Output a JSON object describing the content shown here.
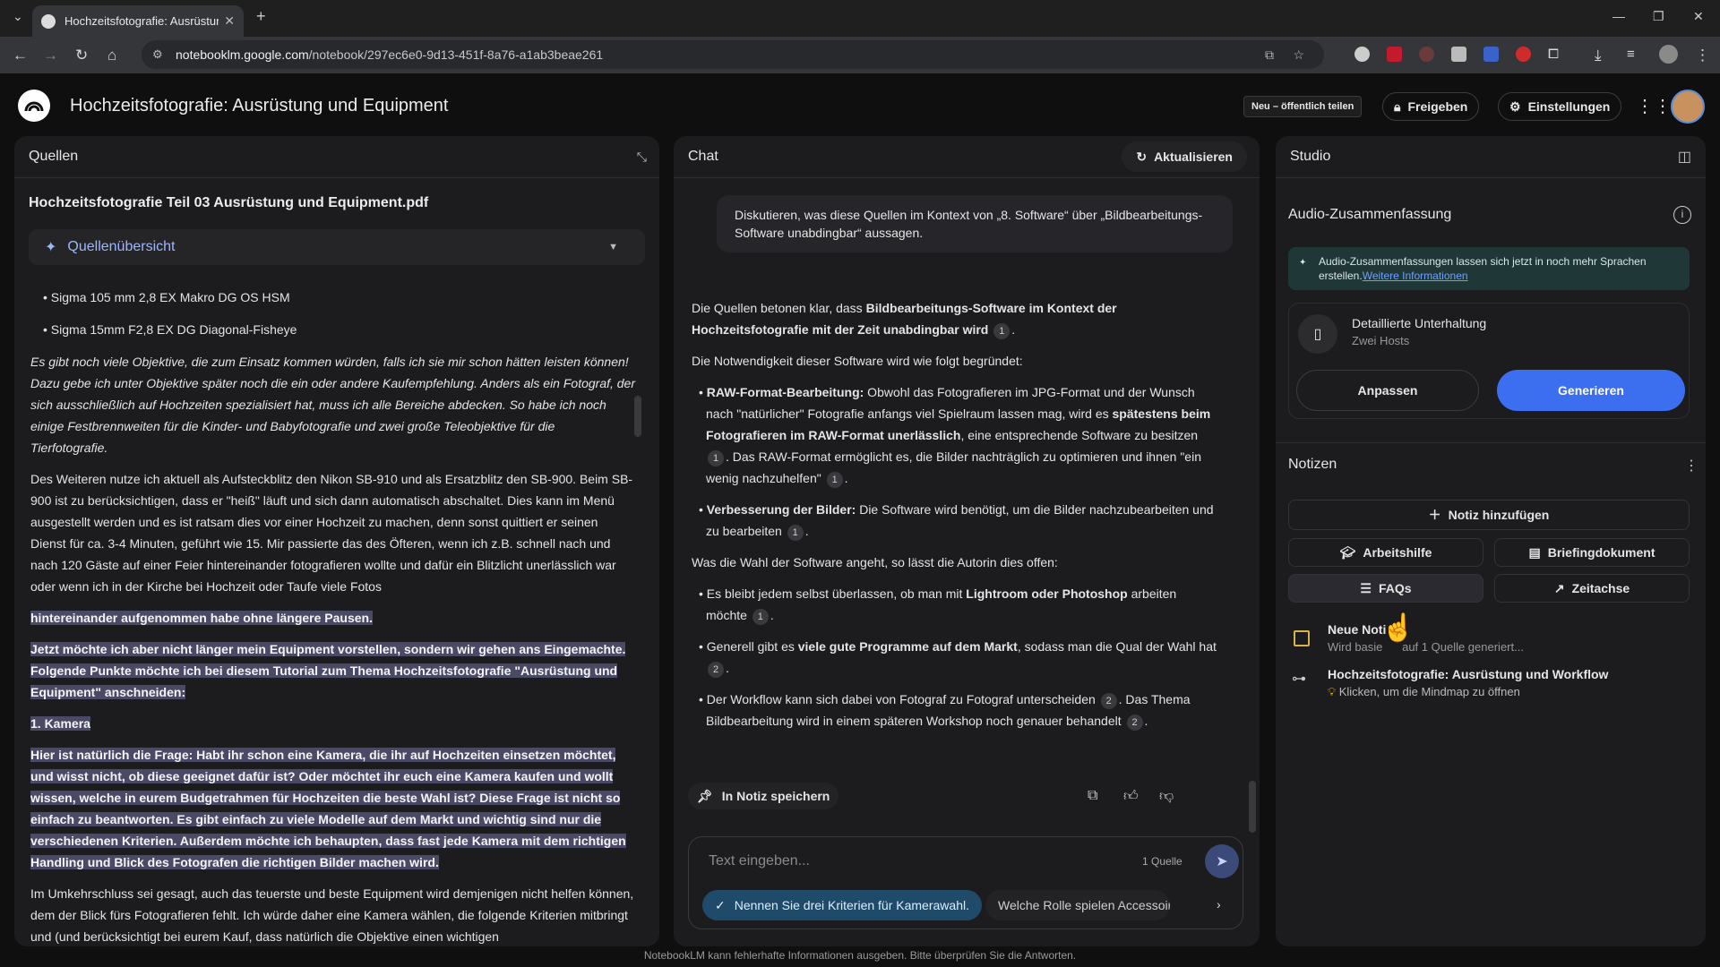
{
  "browser": {
    "tab_title": "Hochzeitsfotografie: Ausrüstun",
    "url_host": "notebooklm.google.com",
    "url_path": "/notebook/297ec6e0-9d13-451f-8a76-a1ab3beae261"
  },
  "app": {
    "title": "Hochzeitsfotografie: Ausrüstung und Equipment",
    "badge": "Neu – öffentlich teilen",
    "share": "Freigeben",
    "settings": "Einstellungen"
  },
  "sources": {
    "header": "Quellen",
    "doc_title": "Hochzeitsfotografie Teil 03 Ausrüstung und Equipment.pdf",
    "overview": "Quellenübersicht",
    "bullets": [
      "• Sigma 105 mm 2,8 EX Makro DG OS HSM",
      "• Sigma 15mm F2,8 EX DG Diagonal-Fisheye"
    ],
    "para1": "Es gibt noch viele Objektive, die zum Einsatz kommen würden, falls ich sie mir schon hätten leisten können! Dazu gebe ich unter Objektive später noch die ein oder andere Kaufempfehlung. Anders als ein Fotograf, der sich ausschließlich auf Hochzeiten spezialisiert hat, muss ich alle Bereiche abdecken. So habe ich noch einige Festbrennweiten für die Kinder- und Babyfotografie und zwei große Teleobjektive für die Tierfotografie.",
    "para2": "Des Weiteren nutze ich aktuell als Aufsteckblitz den Nikon SB-910 und als Ersatzblitz den SB-900. Beim SB-900 ist zu berücksichtigen, dass er \"heiß\" läuft und sich dann automatisch abschaltet. Dies kann im Menü ausgestellt werden und es ist ratsam dies vor einer Hochzeit zu machen, denn sonst quittiert er seinen Dienst für ca. 3-4 Minuten, geführt wie 15. Mir passierte das des Öfteren, wenn ich z.B. schnell nach und nach 120 Gäste auf einer Feier hintereinander fotografieren wollte und dafür ein Blitzlicht unerlässlich war oder wenn ich in der Kirche bei Hochzeit oder Taufe viele Fotos",
    "hl1": "hintereinander aufgenommen habe ohne längere Pausen.",
    "hl2": "Jetzt möchte ich aber nicht länger mein Equipment vorstellen, sondern wir gehen ans Eingemachte. Folgende Punkte möchte ich bei diesem Tutorial zum Thema Hochzeitsfotografie \"Ausrüstung und Equipment\" anschneiden:",
    "hl3": "1. Kamera",
    "hl4": "Hier ist natürlich die Frage: Habt ihr schon eine Kamera, die ihr auf Hochzeiten einsetzen möchtet, und wisst nicht, ob diese geeignet dafür ist? Oder möchtet ihr euch eine Kamera kaufen und wollt wissen, welche in eurem Budgetrahmen für Hochzeiten die beste Wahl ist? Diese Frage ist nicht so einfach zu beantworten. Es gibt einfach zu viele Modelle auf dem Markt und wichtig sind nur die verschiedenen Kriterien. Außerdem möchte ich behaupten, dass fast jede Kamera mit dem richtigen Handling und Blick des Fotografen die richtigen Bilder machen wird.",
    "para3": "Im Umkehrschluss sei gesagt, auch das teuerste und beste Equipment wird demjenigen nicht helfen können, dem der Blick fürs Fotografieren fehlt. Ich würde daher eine Kamera wählen, die folgende Kriterien mitbringt und (und berücksichtigt bei eurem Kauf, dass natürlich die Objektive einen wichtigen"
  },
  "chat": {
    "header": "Chat",
    "refresh": "Aktualisieren",
    "question": "Diskutieren, was diese Quellen im Kontext von „8. Software“ über „Bildbearbeitungs-Software unabdingbar“ aussagen.",
    "a_intro_1": "Die Quellen betonen klar, dass ",
    "a_intro_b": "Bildbearbeitungs-Software im Kontext der Hochzeitsfotografie mit der Zeit unabdingbar wird",
    "a_need": "Die Notwendigkeit dieser Software wird wie folgt begründet:",
    "b1_title": "RAW-Format-Bearbeitung:",
    "b1_text1": " Obwohl das Fotografieren im JPG-Format und der Wunsch nach \"natürlicher\" Fotografie anfangs viel Spielraum lassen mag, wird es ",
    "b1_bold": "spätestens beim Fotografieren im RAW-Format unerlässlich",
    "b1_text2": ", eine entsprechende Software zu besitzen",
    "b1_text3": ". Das RAW-Format ermöglicht es, die Bilder nachträglich zu optimieren und ihnen \"ein wenig nachzuhelfen\"",
    "b2_title": "Verbesserung der Bilder:",
    "b2_text": " Die Software wird benötigt, um die Bilder nachzubearbeiten und zu bearbeiten",
    "a_choice": "Was die Wahl der Software angeht, so lässt die Autorin dies offen:",
    "c1_text": "Es bleibt jedem selbst überlassen, ob man mit ",
    "c1_bold": "Lightroom oder Photoshop",
    "c1_text2": " arbeiten möchte",
    "c2_text": "Generell gibt es ",
    "c2_bold": "viele gute Programme auf dem Markt",
    "c2_text2": ", sodass man die Qual der Wahl hat",
    "c3_text": "Der Workflow kann sich dabei von Fotograf zu Fotograf unterscheiden",
    "c3_text2": ". Das Thema Bildbearbeitung wird in einem späteren Workshop noch genauer behandelt",
    "cite1": "1",
    "cite2": "2",
    "save_note": "In Notiz speichern",
    "input_placeholder": "Text eingeben...",
    "source_count": "1 Quelle",
    "sugg1": "Nennen Sie drei Kriterien für Kamerawahl.",
    "sugg2": "Welche Rolle spielen Accessoires?"
  },
  "studio": {
    "header": "Studio",
    "audio_title": "Audio-Zusammenfassung",
    "banner_text": "Audio-Zusammenfassungen lassen sich jetzt in noch mehr Sprachen erstellen.",
    "banner_link": "Weitere Informationen",
    "card_title": "Detaillierte Unterhaltung",
    "card_sub": "Zwei Hosts",
    "customize": "Anpassen",
    "generate": "Generieren",
    "notes_title": "Notizen",
    "add_note": "Notiz hinzufügen",
    "study_guide": "Arbeitshilfe",
    "briefing": "Briefingdokument",
    "faqs": "FAQs",
    "timeline": "Zeitachse",
    "note1_title": "Neue Noti",
    "note1_sub": "Wird basie",
    "note1_sub2": "auf 1 Quelle generiert...",
    "note2_title": "Hochzeitsfotografie: Ausrüstung und Workflow",
    "note2_sub": "Klicken, um die Mindmap zu öffnen"
  },
  "footer": "NotebookLM kann fehlerhafte Informationen ausgeben. Bitte überprüfen Sie die Antworten.",
  "colors": {
    "accent": "#3c6ef0",
    "highlight": "#4a4966",
    "banner": "#203737"
  }
}
